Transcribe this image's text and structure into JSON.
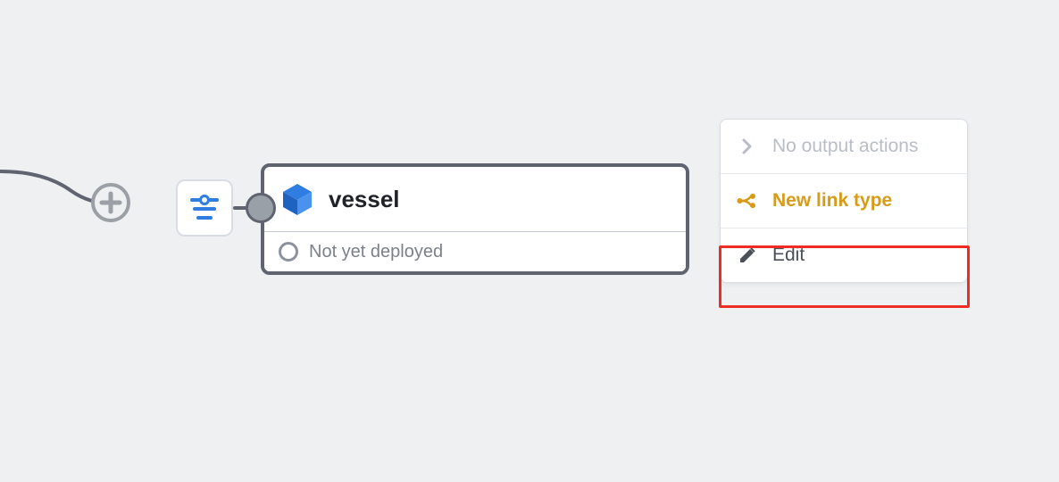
{
  "card": {
    "title": "vessel",
    "status_label": "Not yet deployed"
  },
  "menu": {
    "no_output_label": "No output actions",
    "new_link_label": "New link type",
    "edit_label": "Edit"
  },
  "icons": {
    "plus": "plus-icon",
    "filter": "filter-icon",
    "cube": "cube-icon",
    "chevron": "chevron-right-icon",
    "link": "link-branch-icon",
    "pencil": "pencil-icon",
    "status_empty": "status-empty-icon"
  },
  "colors": {
    "canvas_bg": "#eef0f2",
    "node_border": "#5f6470",
    "accent_blue": "#2f7de1",
    "accent_amber": "#d89b18",
    "muted_text": "#7b818a",
    "disabled_text": "#b9bec6",
    "highlight_red": "#ee2c24"
  }
}
